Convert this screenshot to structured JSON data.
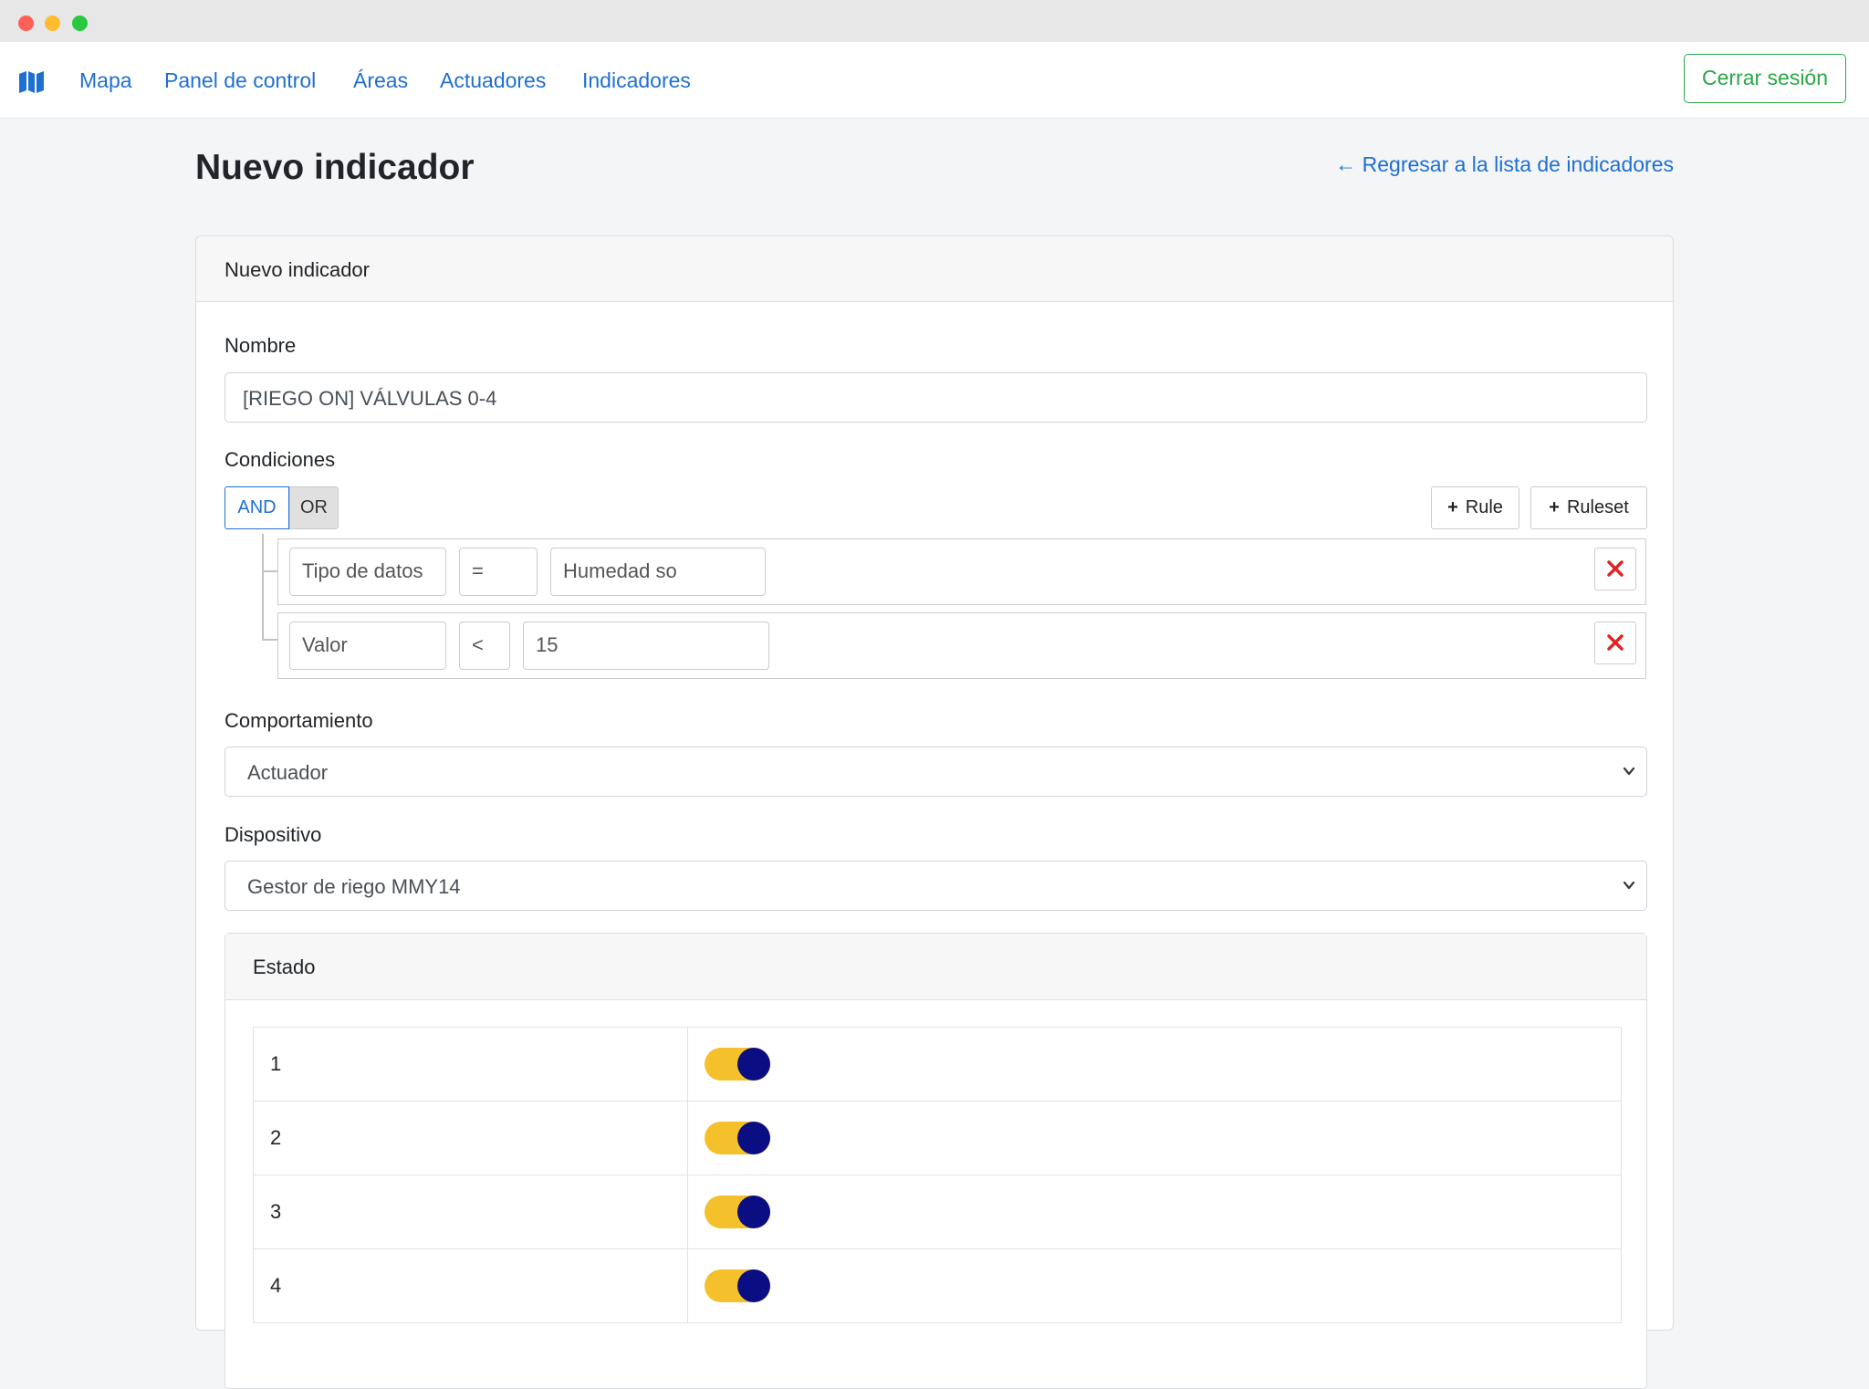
{
  "nav": {
    "brand_icon": "map-icon",
    "links": [
      "Mapa",
      "Panel de control",
      "Áreas",
      "Actuadores",
      "Indicadores"
    ],
    "logout_label": "Cerrar sesión"
  },
  "page": {
    "title": "Nuevo indicador",
    "back_link": "← Regresar a la lista de indicadores"
  },
  "form": {
    "card_title": "Nuevo indicador",
    "name_label": "Nombre",
    "name_value": "[RIEGO ON] VÁLVULAS 0-4",
    "conditions_label": "Condiciones",
    "conditions": {
      "and_label": "AND",
      "or_label": "OR",
      "add_rule_label": "Rule",
      "add_ruleset_label": "Ruleset",
      "active_operator": "AND",
      "rules": [
        {
          "field": "Tipo de datos",
          "operator": "=",
          "value": "Humedad so"
        },
        {
          "field": "Valor",
          "operator": "<",
          "value": "15"
        }
      ]
    },
    "behavior_label": "Comportamiento",
    "behavior_value": "Actuador",
    "device_label": "Dispositivo",
    "device_value": "Gestor de riego MMY14",
    "state_title": "Estado",
    "state_rows": [
      {
        "number": "1",
        "on": true
      },
      {
        "number": "2",
        "on": true
      },
      {
        "number": "3",
        "on": true
      },
      {
        "number": "4",
        "on": true
      }
    ]
  },
  "colors": {
    "link": "#1f6fd1",
    "success": "#28a745",
    "toggle_track": "#f4c12d",
    "toggle_knob": "#0b0e83",
    "delete": "#e02424"
  }
}
